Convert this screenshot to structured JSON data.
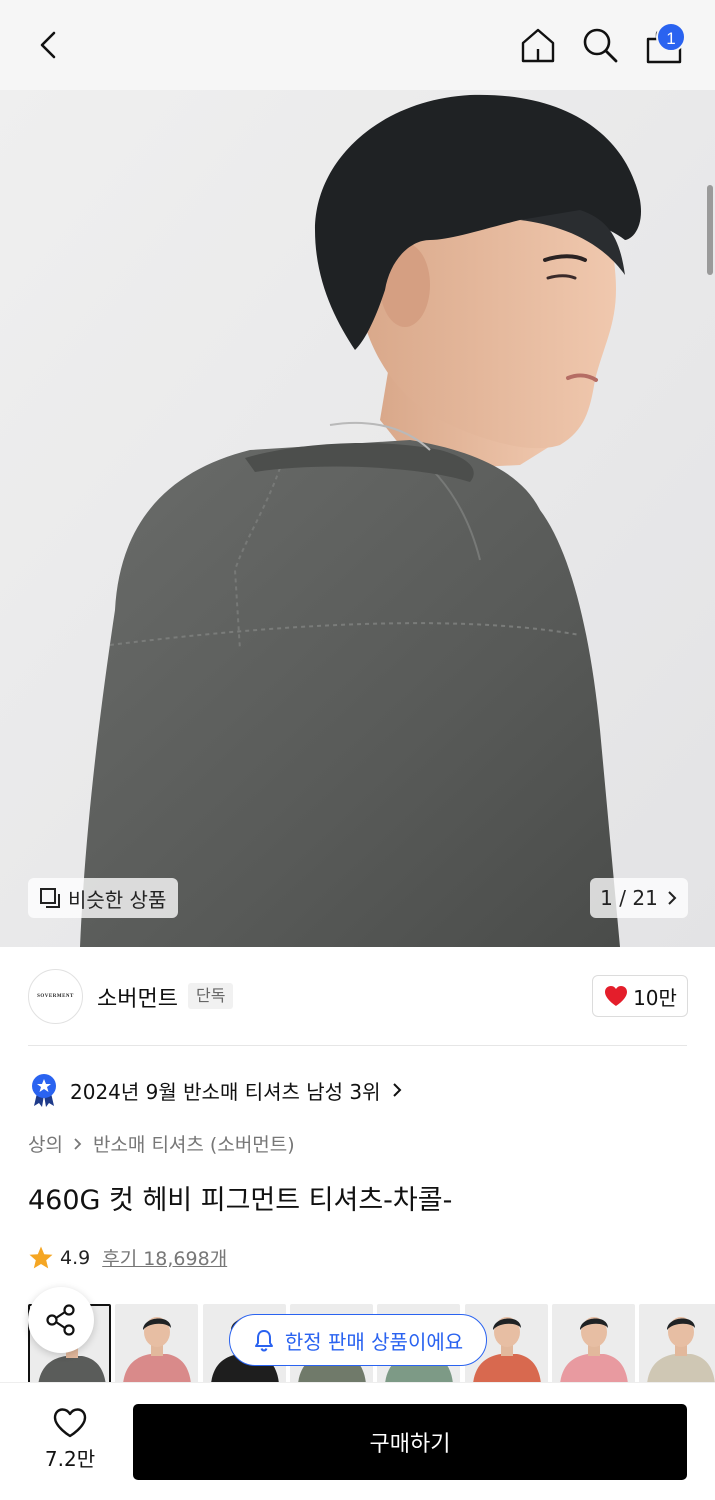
{
  "header": {
    "cart_count": "1"
  },
  "hero": {
    "similar_label": "비슷한 상품",
    "counter": "1 / 21"
  },
  "brand": {
    "logo_text": "SOVERMENT",
    "name": "소버먼트",
    "tag": "단독",
    "likes": "10만"
  },
  "ranking": {
    "text": "2024년 9월 반소매 티셔츠 남성 3위"
  },
  "breadcrumb": {
    "level1": "상의",
    "level2": "반소매 티셔츠 (소버먼트)"
  },
  "product": {
    "title": "460G 컷 헤비 피그먼트 티셔츠-차콜-",
    "rating": "4.9",
    "reviews": "후기 18,698개"
  },
  "limited_notice": "한정 판매 상품이에요",
  "bottom": {
    "wish_count": "7.2만",
    "buy_label": "구매하기"
  },
  "colors": {
    "accent_blue": "#2a63f0",
    "heart_red": "#e41e2b",
    "star": "#f5a623"
  },
  "thumbnail_shirt_colors": [
    "#5a5c5a",
    "#d98a8a",
    "#1e1e1e",
    "#707a6a",
    "#7d9a86",
    "#d8694f",
    "#e89aa0",
    "#cfc7b4"
  ]
}
